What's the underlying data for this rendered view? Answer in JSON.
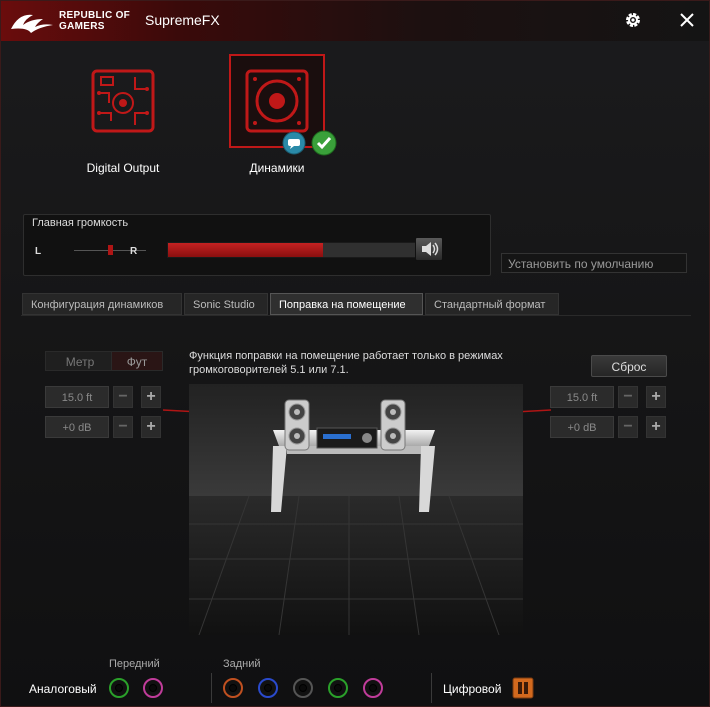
{
  "titlebar": {
    "brand_line1": "REPUBLIC OF",
    "brand_line2": "GAMERS",
    "app_title": "SupremeFX",
    "icons": [
      "rog-logo-icon",
      "gear-icon",
      "close-icon"
    ]
  },
  "devices": [
    {
      "label": "Digital Output",
      "selected": false
    },
    {
      "label": "Динамики",
      "selected": true,
      "badges": [
        "chat-icon",
        "checkmark-icon"
      ]
    }
  ],
  "volume": {
    "title": "Главная громкость",
    "left_label": "L",
    "right_label": "R",
    "level_fraction": 0.6,
    "balance_fraction": 0.5
  },
  "default_button": "Установить по умолчанию",
  "tabs": [
    {
      "label": "Конфигурация динамиков",
      "active": false
    },
    {
      "label": "Sonic Studio",
      "active": false
    },
    {
      "label": "Поправка на помещение",
      "active": true
    },
    {
      "label": "Стандартный формат",
      "active": false
    }
  ],
  "room": {
    "unit_meter": "Метр",
    "unit_foot": "Фут",
    "left_distance": "15.0 ft",
    "left_gain": "+0 dB",
    "right_distance": "15.0 ft",
    "right_gain": "+0 dB",
    "reset": "Сброс",
    "info": "Функция поправки на помещение работает только в режимах громкоговорителей 5.1 или 7.1."
  },
  "bottom": {
    "front_label": "Передний",
    "rear_label": "Задний",
    "analog_label": "Аналоговый",
    "digital_label": "Цифровой",
    "front_jacks": [
      "#2aa02a",
      "#c03c9a"
    ],
    "rear_jacks": [
      "#c05020",
      "#2a4acc",
      "#555555",
      "#2aa02a",
      "#c03c9a"
    ]
  },
  "colors": {
    "accent": "#c01818",
    "ok": "#3aa03a"
  }
}
